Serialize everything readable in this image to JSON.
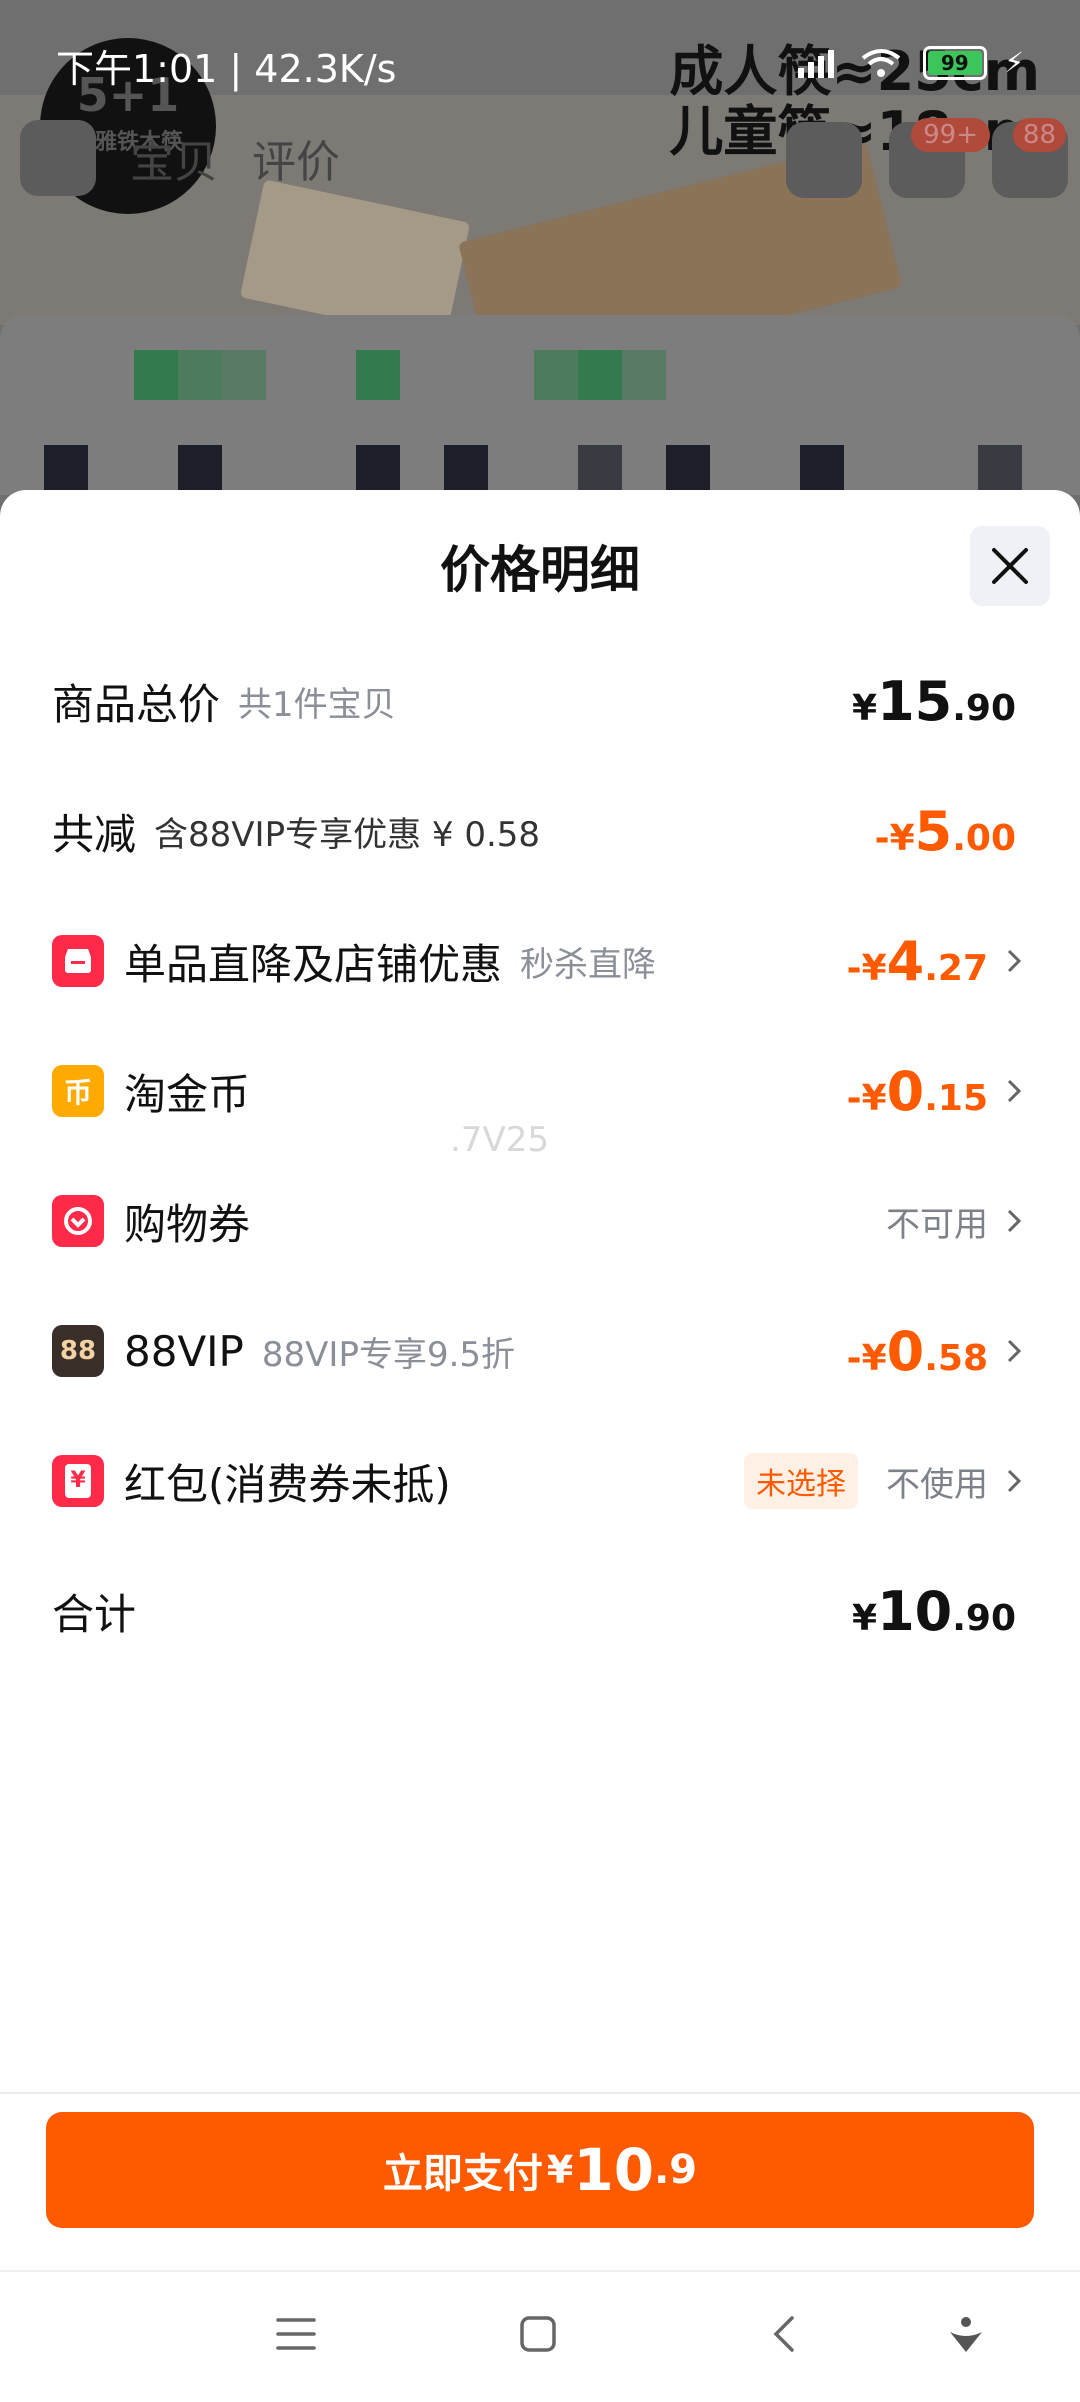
{
  "status_bar": {
    "time": "下午1:01 | 42.3K/s",
    "battery": "99"
  },
  "background_page": {
    "logo_line1": "5+1",
    "logo_line2": "原雅铁木筷",
    "overlay_line1": "成人筷≈25cm",
    "overlay_line2": "儿童筷≈18cm",
    "nav_tab1": "宝贝",
    "nav_tab2": "评价",
    "cart_badge": "99+",
    "vip_badge": "88"
  },
  "sheet": {
    "title": "价格明细",
    "rows": [
      {
        "label": "商品总价",
        "sub": "共1件宝贝",
        "sym": "¥",
        "int": "15",
        "dec": ".90"
      },
      {
        "label": "共减",
        "sub": "含88VIP专享优惠 ¥ 0.58",
        "sym": "-¥",
        "int": "5",
        "dec": ".00"
      },
      {
        "label": "单品直降及店铺优惠",
        "sub": "秒杀直降",
        "sym": "-¥",
        "int": "4",
        "dec": ".27"
      },
      {
        "label": "淘金币",
        "sym": "-¥",
        "int": "0",
        "dec": ".15"
      },
      {
        "label": "购物券",
        "status": "不可用"
      },
      {
        "label": "88VIP",
        "sub": "88VIP专享9.5折",
        "sym": "-¥",
        "int": "0",
        "dec": ".58"
      },
      {
        "label": "红包(消费券未抵)",
        "chip": "未选择",
        "status": "不使用"
      },
      {
        "label": "合计",
        "sym": "¥",
        "int": "10",
        "dec": ".90"
      }
    ],
    "icons": {
      "coin_glyph": "币",
      "vip_glyph": "88",
      "hongbao_glyph": "¥"
    },
    "watermark": ".7V25"
  },
  "footer": {
    "pay_label": "立即支付",
    "pay_sym": "¥",
    "pay_int": "10",
    "pay_dec": ".9"
  },
  "colors": {
    "accent": "#ff5a00",
    "red_icon": "#ff2a4a",
    "gold_icon": "#ffaa00",
    "vip_icon": "#3a2f28"
  },
  "icon_names": [
    "menu-icon",
    "home-icon",
    "back-icon",
    "assistant-icon",
    "close-icon",
    "chevron-right-icon",
    "shop-icon",
    "coin-icon",
    "coupon-icon",
    "vip-icon",
    "hongbao-icon"
  ]
}
